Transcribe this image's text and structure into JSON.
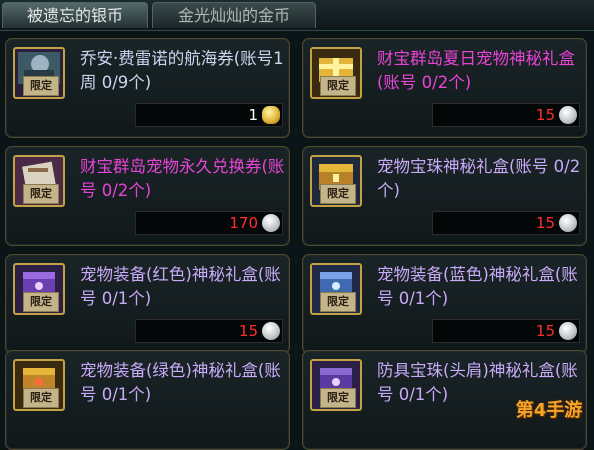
{
  "tabs": [
    {
      "label": "被遗忘的银币",
      "active": true
    },
    {
      "label": "金光灿灿的金币",
      "active": false
    }
  ],
  "items": [
    {
      "title": "乔安·费雷诺的航海券(账号1周 0/9个)",
      "badge": "限定",
      "price": "1",
      "currency": "gold",
      "title_color": "blue"
    },
    {
      "title": "财宝群岛夏日宠物神秘礼盒(账号 0/2个)",
      "badge": "限定",
      "price": "15",
      "currency": "silver",
      "title_color": "pink"
    },
    {
      "title": "财宝群岛宠物永久兑换券(账号 0/2个)",
      "badge": "限定",
      "price": "170",
      "currency": "silver",
      "title_color": "pink"
    },
    {
      "title": "宠物宝珠神秘礼盒(账号 0/2个)",
      "badge": "限定",
      "price": "15",
      "currency": "silver",
      "title_color": "lavender"
    },
    {
      "title": "宠物装备(红色)神秘礼盒(账号 0/1个)",
      "badge": "限定",
      "price": "15",
      "currency": "silver",
      "title_color": "lavender"
    },
    {
      "title": "宠物装备(蓝色)神秘礼盒(账号 0/1个)",
      "badge": "限定",
      "price": "15",
      "currency": "silver",
      "title_color": "lavender"
    },
    {
      "title": "宠物装备(绿色)神秘礼盒(账号 0/1个)",
      "badge": "限定",
      "price": "",
      "currency": "",
      "title_color": "lavender"
    },
    {
      "title": "防具宝珠(头肩)神秘礼盒(账号 0/1个)",
      "badge": "限定",
      "price": "",
      "currency": "",
      "title_color": "lavender"
    }
  ],
  "watermark": "第4手游",
  "colors": {
    "price": "#ff2d2d",
    "gold_price": "#ffffff",
    "card_border": "#53492c",
    "icon_border": "#c2a244"
  }
}
